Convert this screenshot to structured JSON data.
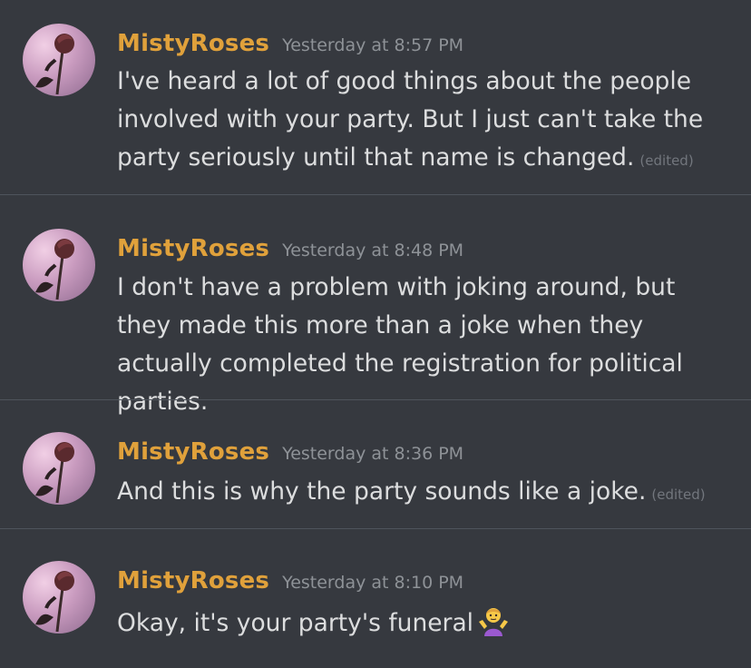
{
  "messages": [
    {
      "author": "MistyRoses",
      "timestamp": "Yesterday at 8:57 PM",
      "text": "I've heard a lot of good things about the people involved with your party. But I just can't take the party seriously until that name is changed.",
      "edited_label": "(edited)"
    },
    {
      "author": "MistyRoses",
      "timestamp": "Yesterday at 8:48 PM",
      "text": "I don't have a problem with joking around, but they made this more than a joke when they actually completed the registration for political parties."
    },
    {
      "author": "MistyRoses",
      "timestamp": "Yesterday at 8:36 PM",
      "text": "And this is why the party sounds like a joke.",
      "edited_label": "(edited)"
    },
    {
      "author": "MistyRoses",
      "timestamp": "Yesterday at 8:10 PM",
      "text": "Okay, it's your party's funeral",
      "emoji": "person-shrugging-emoji"
    }
  ],
  "colors": {
    "background": "#36393f",
    "username": "#e0a13b",
    "timestamp": "#8e9297",
    "message_text": "#dcddde",
    "edited": "#72767d",
    "divider": "#4f545c"
  },
  "icons": {
    "avatar": "rose-avatar"
  }
}
